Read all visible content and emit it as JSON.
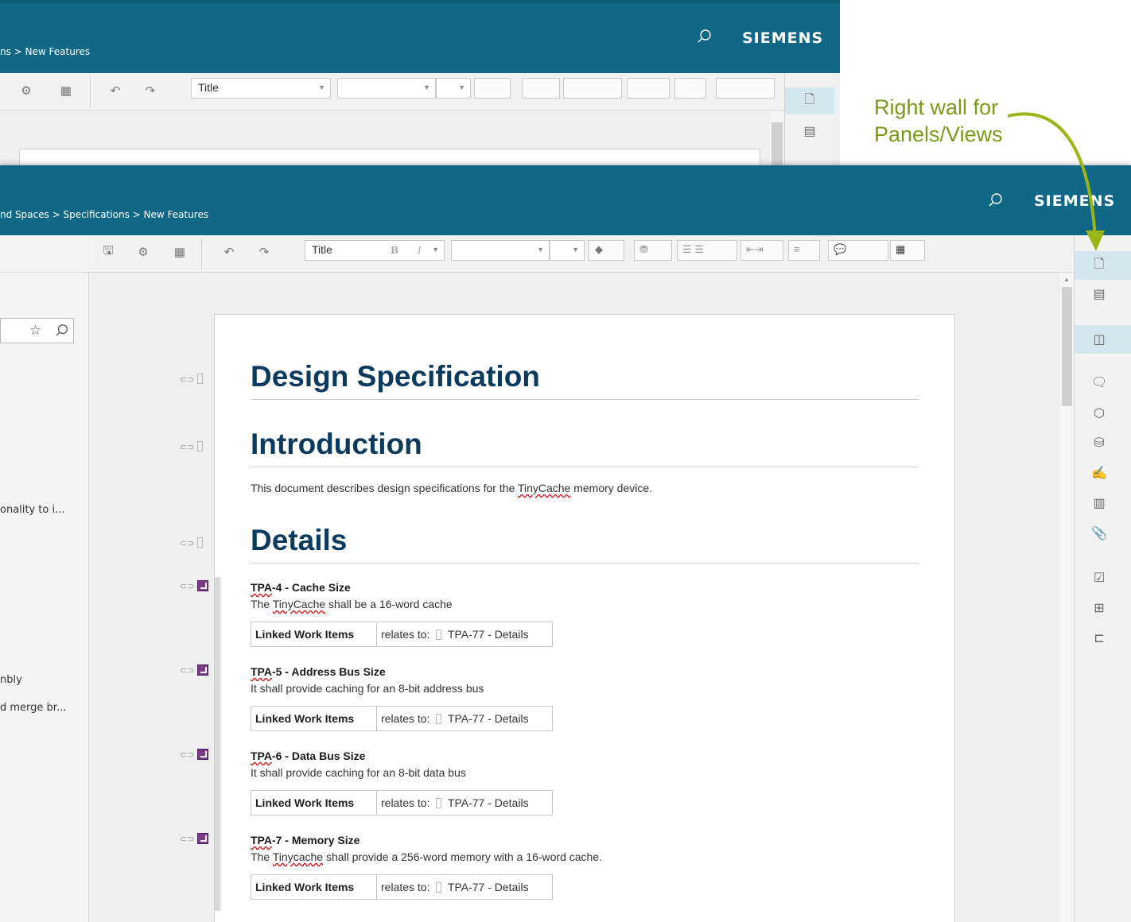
{
  "annotation": {
    "line1": "Right wall for",
    "line2": "Panels/Views"
  },
  "back_window": {
    "breadcrumb": "ns > New Features",
    "brand": "SIEMENS",
    "style_combo": "Title"
  },
  "front_window": {
    "breadcrumb": "nd Spaces > Specifications > New Features",
    "brand": "SIEMENS",
    "style_combo": "Title"
  },
  "left_panel": {
    "snippets": [
      "onality to i...",
      "nbly",
      "d merge br..."
    ]
  },
  "document": {
    "title": "Design Specification",
    "intro_heading": "Introduction",
    "intro_text_before": "This document describes design specifications for the ",
    "intro_text_term": "TinyCache",
    "intro_text_after": " memory device.",
    "details_heading": "Details",
    "linked_label": "Linked Work Items",
    "items": [
      {
        "id": "TPA",
        "rest": "-4 - Cache Size",
        "desc_pre": "The ",
        "desc_term": "TinyCache",
        "desc_post": " shall be a 16-word cache",
        "rel_prefix": "relates to:",
        "rel_target": "TPA-77 - Details"
      },
      {
        "id": "TPA",
        "rest": "-5 - Address Bus Size",
        "desc_pre": "It shall provide caching for an 8-bit address bus",
        "desc_term": "",
        "desc_post": "",
        "rel_prefix": "relates to:",
        "rel_target": "TPA-77 - Details"
      },
      {
        "id": "TPA",
        "rest": "-6 - Data Bus Size",
        "desc_pre": "It shall provide caching for an 8-bit data bus",
        "desc_term": "",
        "desc_post": "",
        "rel_prefix": "relates to:",
        "rel_target": "TPA-77 - Details"
      },
      {
        "id": "TPA",
        "rest": "-7 - Memory Size",
        "desc_pre": "The ",
        "desc_term": "Tinycache",
        "desc_post": " shall provide a 256-word memory with a 16-word cache.",
        "rel_prefix": "relates to:",
        "rel_target": "TPA-77 - Details"
      }
    ]
  },
  "colors": {
    "header": "#106786",
    "heading": "#0b3a5d",
    "annotation": "#7a9a1a",
    "rail_highlight": "#d3e6ee"
  }
}
